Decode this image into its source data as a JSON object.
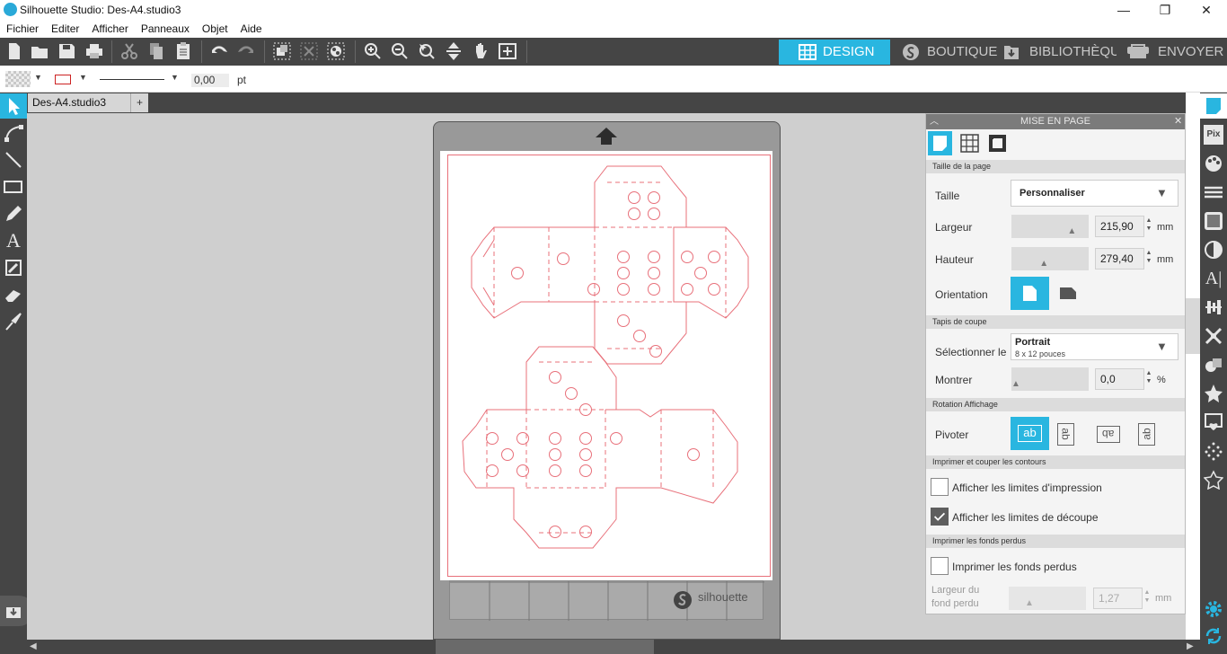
{
  "app": {
    "window_title": "Silhouette Studio: Des-A4.studio3",
    "minimize": "—",
    "restore": "❐",
    "close": "✕"
  },
  "menu": [
    "Fichier",
    "Editer",
    "Afficher",
    "Panneaux",
    "Objet",
    "Aide"
  ],
  "nav": {
    "design": "DESIGN",
    "boutique": "BOUTIQUE",
    "bibliotheque": "BIBLIOTHÈQUE",
    "envoyer": "ENVOYER"
  },
  "options": {
    "line_width_value": "0,00",
    "line_width_unit": "pt"
  },
  "document": {
    "tab_name": "Des-A4.studio3",
    "add_tab": "+"
  },
  "mat": {
    "brand": "silhouette"
  },
  "panel": {
    "title": "MISE EN PAGE",
    "sections": {
      "page_size": "Taille de la page",
      "mat": "Tapis de coupe",
      "rotation": "Rotation Affichage",
      "print_cut": "Imprimer et couper les contours",
      "bleed": "Imprimer les fonds perdus"
    },
    "taille": {
      "label": "Taille",
      "value": "Personnaliser"
    },
    "largeur": {
      "label": "Largeur",
      "value": "215,90",
      "unit": "mm",
      "slider_fraction": 0.8
    },
    "hauteur": {
      "label": "Hauteur",
      "value": "279,40",
      "unit": "mm",
      "slider_fraction": 0.4
    },
    "orientation": {
      "label": "Orientation",
      "selected": "portrait"
    },
    "select_mat": {
      "label": "Sélectionner le",
      "value": "Portrait",
      "sub": "8 x 12 pouces"
    },
    "montrer": {
      "label": "Montrer",
      "value": "0,0",
      "unit": "%",
      "slider_fraction": 0.0
    },
    "pivoter": {
      "label": "Pivoter",
      "icon_text": "ab"
    },
    "print_limits": {
      "label": "Afficher les limites d'impression",
      "checked": false
    },
    "cut_limits": {
      "label": "Afficher les limites de découpe",
      "checked": true
    },
    "bleed_print": {
      "label": "Imprimer les fonds perdus",
      "checked": false
    },
    "bleed_width": {
      "label1": "Largeur du",
      "label2": "fond perdu",
      "value": "1,27",
      "unit": "mm"
    }
  },
  "colors": {
    "accent": "#29b6e0",
    "chrome": "#454545",
    "cut_line": "#e8707a"
  }
}
